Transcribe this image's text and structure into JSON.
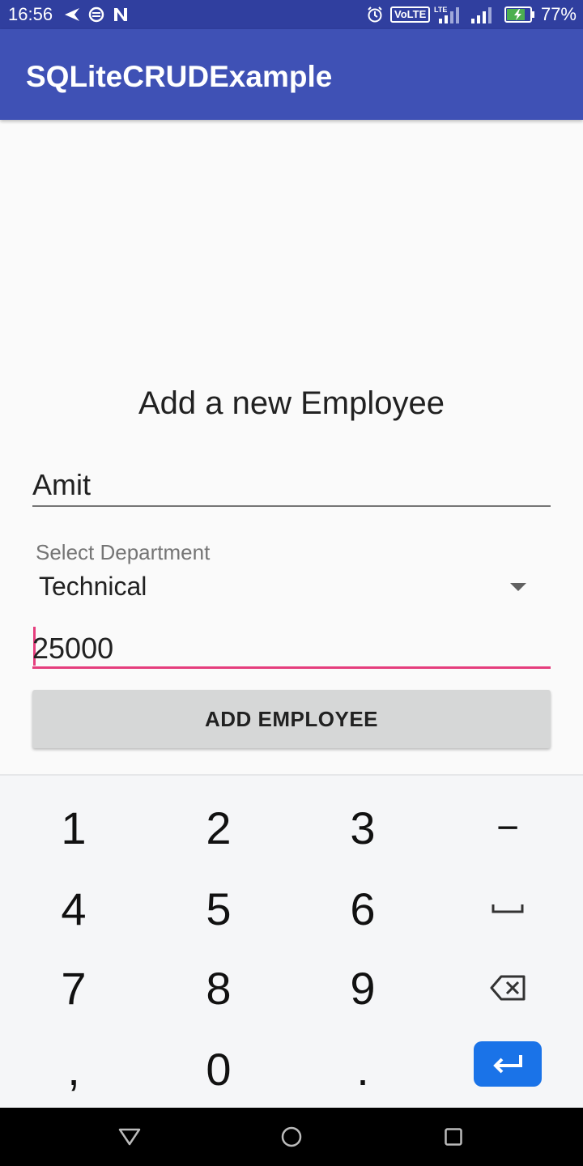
{
  "status_bar": {
    "time": "16:56",
    "network_badge": "VoLTE",
    "lte_label": "LTE",
    "battery": "77%"
  },
  "app_bar": {
    "title": "SQLiteCRUDExample"
  },
  "form": {
    "heading": "Add a new Employee",
    "name_value": "Amit",
    "department_label": "Select Department",
    "department_value": "Technical",
    "salary_value": "25000",
    "add_button_label": "ADD EMPLOYEE"
  },
  "keyboard": {
    "row1": [
      "1",
      "2",
      "3",
      "−"
    ],
    "row2": [
      "4",
      "5",
      "6"
    ],
    "row3": [
      "7",
      "8",
      "9"
    ],
    "row4": [
      ",",
      "0",
      "."
    ]
  },
  "colors": {
    "status_bar": "#303f9f",
    "app_bar": "#3f51b5",
    "accent": "#e53e7d",
    "button": "#d6d7d7",
    "enter_key": "#1a73e8"
  }
}
